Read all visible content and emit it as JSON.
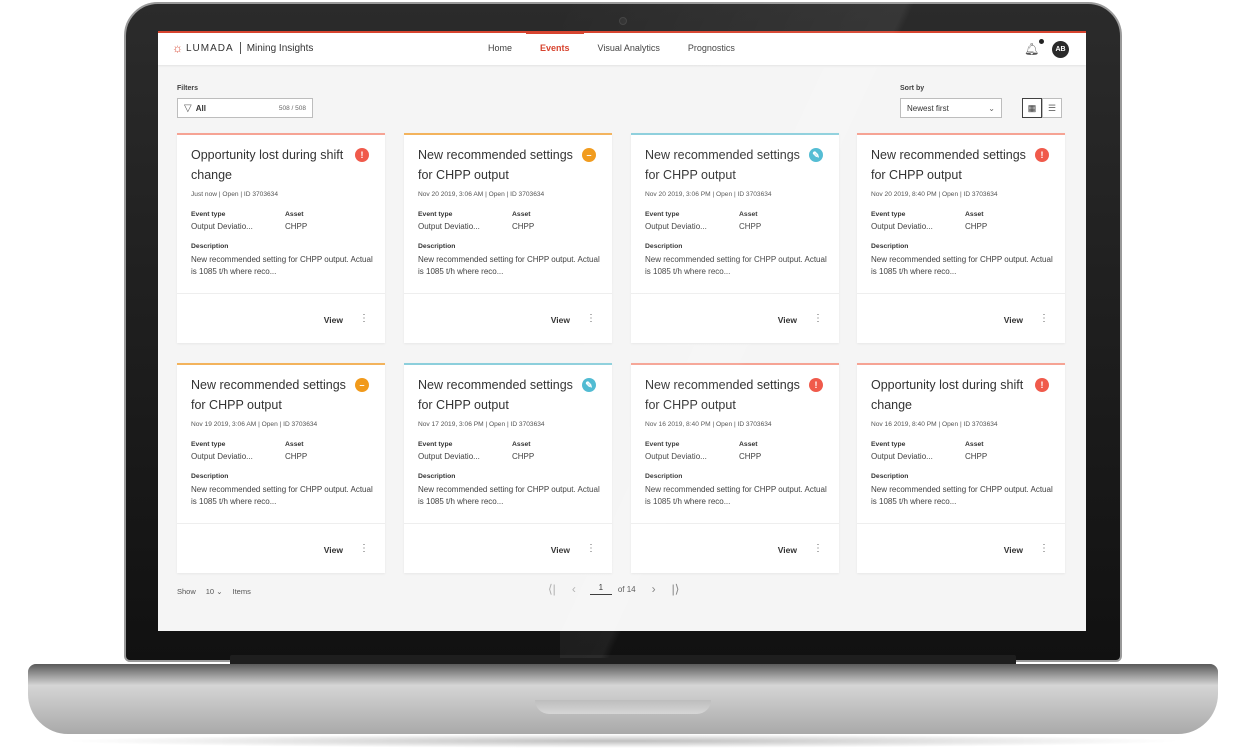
{
  "app": {
    "brand": "LUMADA",
    "name": "Mining Insights"
  },
  "nav": [
    {
      "label": "Home",
      "active": false
    },
    {
      "label": "Events",
      "active": true
    },
    {
      "label": "Visual Analytics",
      "active": false
    },
    {
      "label": "Prognostics",
      "active": false
    }
  ],
  "user": {
    "initials": "AB"
  },
  "filters": {
    "label": "Filters",
    "value": "All",
    "count": "508 / 508"
  },
  "sort": {
    "label": "Sort by",
    "value": "Newest first"
  },
  "card_labels": {
    "event_type": "Event type",
    "asset": "Asset",
    "description": "Description",
    "view": "View"
  },
  "severity_colors": {
    "critical": "#f05a4b",
    "warning": "#f19a1b",
    "info": "#4bb9d1"
  },
  "bar_colors": {
    "critical": "#f6a394",
    "warning": "#f3b35c",
    "info": "#8ccfdc"
  },
  "cards": [
    {
      "title": "Opportunity lost during shift change",
      "meta": "Just now  |  Open  |  ID 3703634",
      "event_type": "Output Deviatio...",
      "asset": "CHPP",
      "description": "New recommended setting for CHPP output. Actual is 1085 t/h where reco...",
      "severity": "critical",
      "icon": "!"
    },
    {
      "title": "New recommended settings for CHPP output",
      "meta": "Nov 20 2019, 3:06 AM  |  Open  |  ID 3703634",
      "event_type": "Output Deviatio...",
      "asset": "CHPP",
      "description": "New recommended setting for CHPP output. Actual is 1085 t/h where reco...",
      "severity": "warning",
      "icon": "–"
    },
    {
      "title": "New recommended settings for CHPP output",
      "meta": "Nov 20 2019, 3:06 PM  |  Open  |  ID 3703634",
      "event_type": "Output Deviatio...",
      "asset": "CHPP",
      "description": "New recommended setting for CHPP output. Actual is 1085 t/h where reco...",
      "severity": "info",
      "icon": "✎"
    },
    {
      "title": "New recommended settings for CHPP output",
      "meta": "Nov 20 2019, 8:40 PM  |  Open  |  ID 3703634",
      "event_type": "Output Deviatio...",
      "asset": "CHPP",
      "description": "New recommended setting for CHPP output. Actual is 1085 t/h where reco...",
      "severity": "critical",
      "icon": "!"
    },
    {
      "title": "New recommended settings for CHPP output",
      "meta": "Nov 19 2019, 3:06 AM  |  Open  |  ID 3703634",
      "event_type": "Output Deviatio...",
      "asset": "CHPP",
      "description": "New recommended setting for CHPP output. Actual is 1085 t/h where reco...",
      "severity": "warning",
      "icon": "–"
    },
    {
      "title": "New recommended settings for CHPP output",
      "meta": "Nov 17 2019, 3:06 PM  |  Open  |  ID 3703634",
      "event_type": "Output Deviatio...",
      "asset": "CHPP",
      "description": "New recommended setting for CHPP output. Actual is 1085 t/h where reco...",
      "severity": "info",
      "icon": "✎"
    },
    {
      "title": "New recommended settings for CHPP output",
      "meta": "Nov 16 2019, 8:40 PM  |  Open  |  ID 3703634",
      "event_type": "Output Deviatio...",
      "asset": "CHPP",
      "description": "New recommended setting for CHPP output. Actual is 1085 t/h where reco...",
      "severity": "critical",
      "icon": "!"
    },
    {
      "title": "Opportunity lost during shift change",
      "meta": "Nov 16 2019, 8:40 PM  |  Open  |  ID 3703634",
      "event_type": "Output Deviatio...",
      "asset": "CHPP",
      "description": "New recommended setting for CHPP output. Actual is 1085 t/h where reco...",
      "severity": "critical",
      "icon": "!"
    }
  ],
  "pagination": {
    "show_label": "Show",
    "page_size": "10",
    "items_label": "Items",
    "current_page": "1",
    "of_label": "of 14"
  }
}
